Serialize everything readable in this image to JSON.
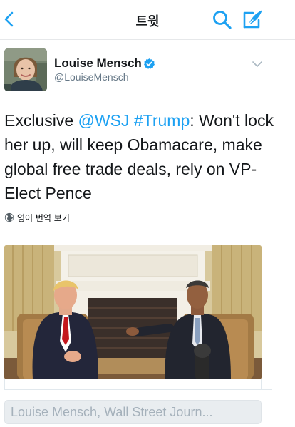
{
  "navbar": {
    "title": "트윗",
    "back_icon": "chevron-left-icon",
    "search_icon": "search-icon",
    "compose_icon": "compose-icon",
    "accent_color": "#1da1f2"
  },
  "tweet": {
    "author": {
      "name": "Louise Mensch",
      "handle": "@LouiseMensch",
      "verified": true
    },
    "text": {
      "lead": "Exclusive ",
      "mention": "@WSJ",
      "space": " ",
      "hashtag": "#Trump",
      "rest": ": Won't lock her up, will keep Obamacare, make global free trade deals, rely on VP-Elect Pence"
    },
    "translate_label": "영어 번역 보기",
    "media": {
      "alt": "Photo of two men seated in armchairs in front of a fireplace"
    }
  },
  "reply": {
    "placeholder": "Louise Mensch, Wall Street Journ..."
  }
}
